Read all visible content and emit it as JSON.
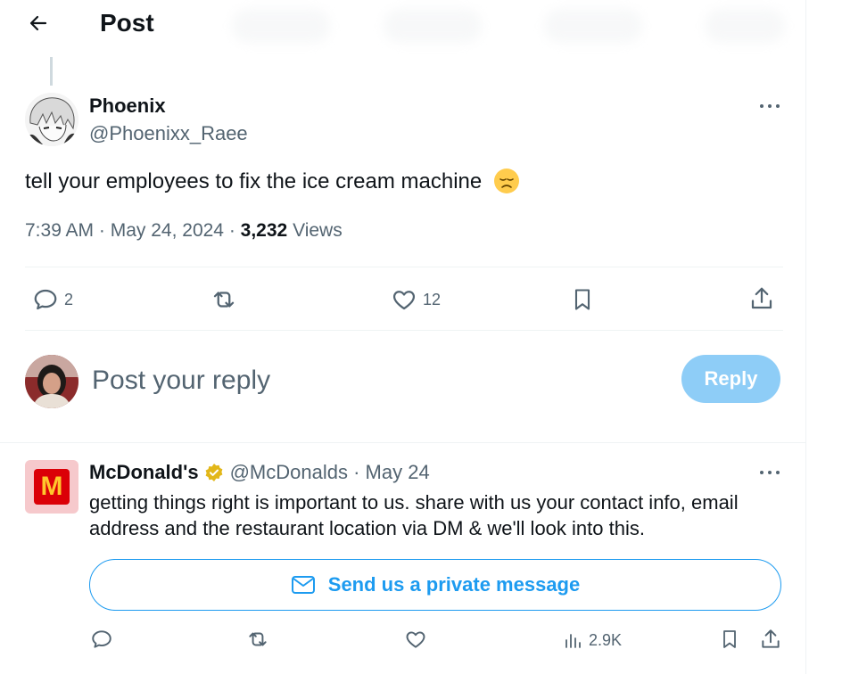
{
  "header": {
    "title": "Post"
  },
  "tweet": {
    "author_name": "Phoenix",
    "author_handle": "@Phoenixx_Raee",
    "text": "tell your employees to fix the ice cream machine",
    "emoji": "disappointed-face",
    "time": "7:39 AM",
    "date": "May 24, 2024",
    "views_count": "3,232",
    "views_label": "Views",
    "replies": "2",
    "likes": "12"
  },
  "composer": {
    "placeholder": "Post your reply",
    "reply_label": "Reply"
  },
  "reply": {
    "name": "McDonald's",
    "handle": "@McDonalds",
    "date": "May 24",
    "text": "getting things right is important to us. share with us your contact info, email address and the restaurant location via DM & we'll look into this.",
    "dm_label": "Send us a private message",
    "views": "2.9K",
    "logo_letter": "M"
  },
  "colors": {
    "accent": "#1d9bf0",
    "reply_button_disabled": "#8ecdf7",
    "secondary_text": "#536471",
    "verified_gold": "#e2b719"
  }
}
